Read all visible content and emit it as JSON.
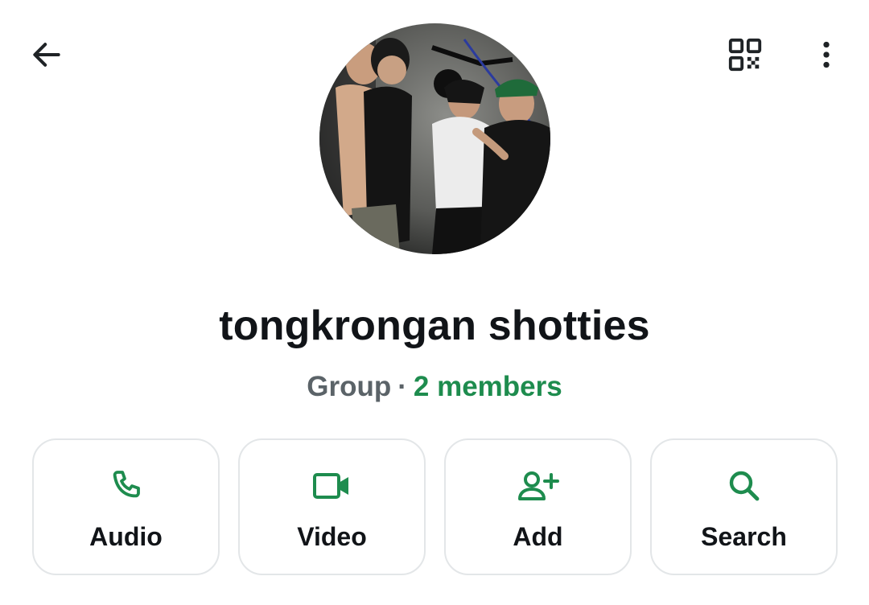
{
  "header": {
    "back_icon": "arrow-left-icon",
    "qr_icon": "qr-code-icon",
    "more_icon": "more-vertical-icon"
  },
  "profile": {
    "name": "tongkrongan shotties",
    "type_label": "Group",
    "separator": "·",
    "members_label": "2 members"
  },
  "actions": [
    {
      "label": "Audio",
      "icon": "phone-icon"
    },
    {
      "label": "Video",
      "icon": "video-camera-icon"
    },
    {
      "label": "Add",
      "icon": "add-person-icon"
    },
    {
      "label": "Search",
      "icon": "search-icon"
    }
  ],
  "colors": {
    "accent": "#1e8c4e",
    "text": "#111418",
    "muted": "#5b6368",
    "border": "#e3e6e8"
  }
}
